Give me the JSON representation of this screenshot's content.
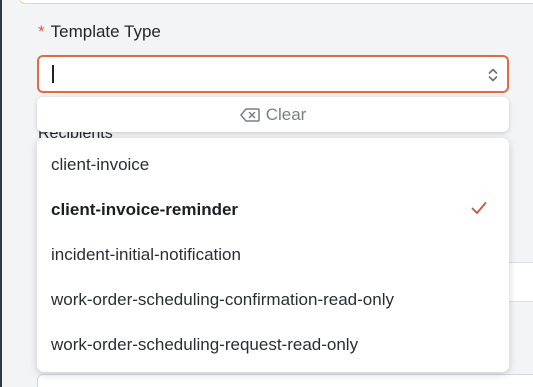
{
  "field": {
    "label": "Template Type",
    "required_mark": "*",
    "value": ""
  },
  "clear": {
    "label": "Clear",
    "icon": "backspace-clear-icon"
  },
  "background": {
    "recipients_label": "Recipients"
  },
  "options": [
    {
      "label": "client-invoice",
      "selected": false
    },
    {
      "label": "client-invoice-reminder",
      "selected": true
    },
    {
      "label": "incident-initial-notification",
      "selected": false
    },
    {
      "label": "work-order-scheduling-confirmation-read-only",
      "selected": false
    },
    {
      "label": "work-order-scheduling-request-read-only",
      "selected": false
    }
  ],
  "colors": {
    "accent": "#e46a43",
    "required": "#e15b3a",
    "check": "#c8553a"
  }
}
